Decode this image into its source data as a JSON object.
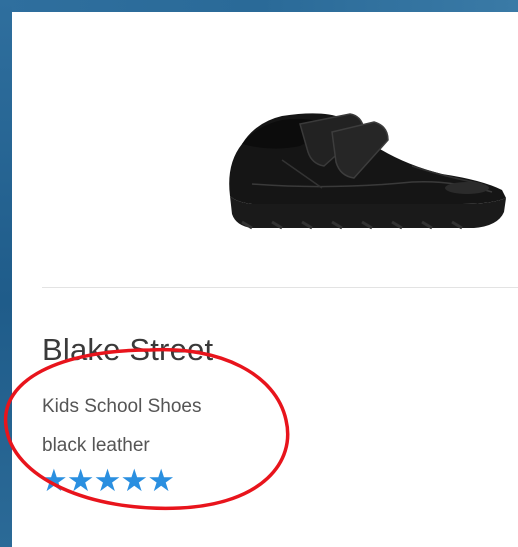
{
  "product": {
    "name": "Blake Street",
    "category": "Kids School Shoes",
    "color": "black leather",
    "rating": 5,
    "rating_max": 5,
    "stars": [
      "★",
      "★",
      "★",
      "★",
      "★"
    ],
    "image_icon": "shoe-image"
  },
  "colors": {
    "frame": "#1f5c8a",
    "star": "#2a8fe0",
    "annotation": "#e8141c",
    "title_text": "#3a3a3a",
    "body_text": "#555555"
  }
}
